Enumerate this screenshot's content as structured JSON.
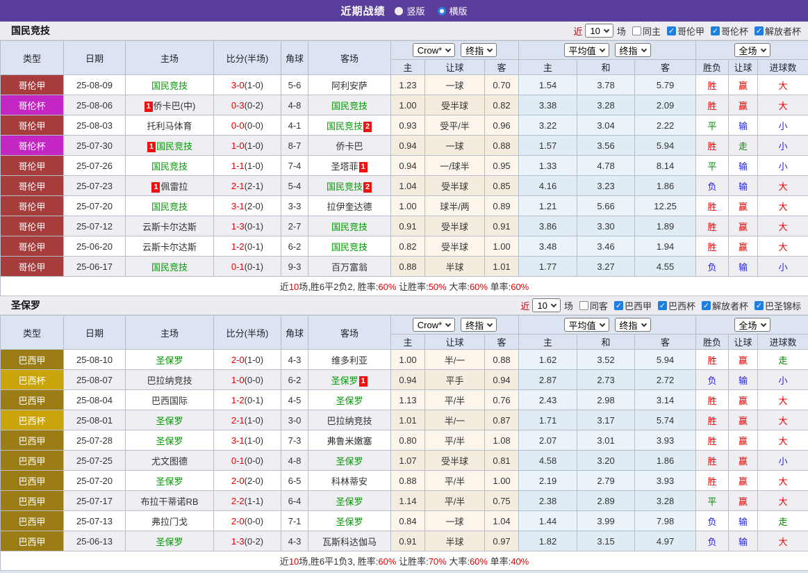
{
  "titlebar": {
    "title": "近期战绩",
    "radios": [
      {
        "label": "竖版",
        "style": "filled"
      },
      {
        "label": "横版",
        "style": "ring"
      }
    ]
  },
  "table_header": {
    "cols": [
      "类型",
      "日期",
      "主场",
      "比分(半场)",
      "角球",
      "客场"
    ],
    "sub": [
      "主",
      "让球",
      "客",
      "主",
      "和",
      "客",
      "胜负",
      "让球",
      "进球数"
    ],
    "selects": {
      "crow": "Crow*",
      "crow_final": "终指",
      "avg": "平均值",
      "avg_final": "终指",
      "full": "全场"
    }
  },
  "league_colors": {
    "哥伦甲": "#a73c3c",
    "哥伦杯": "#c426c4",
    "巴西甲": "#9c7c14",
    "巴西杯": "#c9a40c"
  },
  "result_colors": {
    "胜": "#e60000",
    "赢": "#e60000",
    "大": "#e60000",
    "平": "#008800",
    "走": "#008800",
    "负": "#2222dd",
    "输": "#2222dd",
    "小": "#2222dd"
  },
  "colors": {
    "titlebar": "#5a3e9b",
    "focus_team": "#009900",
    "score": "#e00000",
    "badge": "#ee1111"
  },
  "sections": [
    {
      "team": "国民竞技",
      "filters": {
        "near": "近",
        "count": "10",
        "unit": "场",
        "same": {
          "label": "同主",
          "checked": false
        },
        "leagues": [
          {
            "label": "哥伦甲",
            "checked": true
          },
          {
            "label": "哥伦杯",
            "checked": true
          },
          {
            "label": "解放者杯",
            "checked": true
          }
        ]
      },
      "rows": [
        {
          "league": "哥伦甲",
          "date": "25-08-09",
          "home": {
            "name": "国民竞技",
            "focus": true
          },
          "score": "3-0",
          "half": "(1-0)",
          "corner": "5-6",
          "away": {
            "name": "阿利安萨",
            "focus": false
          },
          "odds": [
            "1.23",
            "一球",
            "0.70",
            "1.54",
            "3.78",
            "5.79"
          ],
          "results": [
            "胜",
            "赢",
            "大"
          ]
        },
        {
          "league": "哥伦杯",
          "date": "25-08-06",
          "home": {
            "name": "侨卡巴(中)",
            "focus": false,
            "badge": "1"
          },
          "score": "0-3",
          "half": "(0-2)",
          "corner": "4-8",
          "away": {
            "name": "国民竞技",
            "focus": true
          },
          "odds": [
            "1.00",
            "受半球",
            "0.82",
            "3.38",
            "3.28",
            "2.09"
          ],
          "results": [
            "胜",
            "赢",
            "大"
          ]
        },
        {
          "league": "哥伦甲",
          "date": "25-08-03",
          "home": {
            "name": "托利马体育",
            "focus": false
          },
          "score": "0-0",
          "half": "(0-0)",
          "corner": "4-1",
          "away": {
            "name": "国民竞技",
            "focus": true,
            "badge": "2"
          },
          "odds": [
            "0.93",
            "受平/半",
            "0.96",
            "3.22",
            "3.04",
            "2.22"
          ],
          "results": [
            "平",
            "输",
            "小"
          ]
        },
        {
          "league": "哥伦杯",
          "date": "25-07-30",
          "home": {
            "name": "国民竞技",
            "focus": true,
            "badge": "1"
          },
          "score": "1-0",
          "half": "(1-0)",
          "corner": "8-7",
          "away": {
            "name": "侨卡巴",
            "focus": false
          },
          "odds": [
            "0.94",
            "一球",
            "0.88",
            "1.57",
            "3.56",
            "5.94"
          ],
          "results": [
            "胜",
            "走",
            "小"
          ]
        },
        {
          "league": "哥伦甲",
          "date": "25-07-26",
          "home": {
            "name": "国民竞技",
            "focus": true
          },
          "score": "1-1",
          "half": "(1-0)",
          "corner": "7-4",
          "away": {
            "name": "圣塔菲",
            "focus": false,
            "badge": "1"
          },
          "odds": [
            "0.94",
            "一/球半",
            "0.95",
            "1.33",
            "4.78",
            "8.14"
          ],
          "results": [
            "平",
            "输",
            "小"
          ]
        },
        {
          "league": "哥伦甲",
          "date": "25-07-23",
          "home": {
            "name": "佩雷拉",
            "focus": false,
            "badge": "1"
          },
          "score": "2-1",
          "half": "(2-1)",
          "corner": "5-4",
          "away": {
            "name": "国民竞技",
            "focus": true,
            "badge": "2"
          },
          "odds": [
            "1.04",
            "受半球",
            "0.85",
            "4.16",
            "3.23",
            "1.86"
          ],
          "results": [
            "负",
            "输",
            "大"
          ]
        },
        {
          "league": "哥伦甲",
          "date": "25-07-20",
          "home": {
            "name": "国民竞技",
            "focus": true
          },
          "score": "3-1",
          "half": "(2-0)",
          "corner": "3-3",
          "away": {
            "name": "拉伊奎达德",
            "focus": false
          },
          "odds": [
            "1.00",
            "球半/两",
            "0.89",
            "1.21",
            "5.66",
            "12.25"
          ],
          "results": [
            "胜",
            "赢",
            "大"
          ]
        },
        {
          "league": "哥伦甲",
          "date": "25-07-12",
          "home": {
            "name": "云斯卡尔达斯",
            "focus": false
          },
          "score": "1-3",
          "half": "(0-1)",
          "corner": "2-7",
          "away": {
            "name": "国民竞技",
            "focus": true
          },
          "odds": [
            "0.91",
            "受半球",
            "0.91",
            "3.86",
            "3.30",
            "1.89"
          ],
          "results": [
            "胜",
            "赢",
            "大"
          ]
        },
        {
          "league": "哥伦甲",
          "date": "25-06-20",
          "home": {
            "name": "云斯卡尔达斯",
            "focus": false
          },
          "score": "1-2",
          "half": "(0-1)",
          "corner": "6-2",
          "away": {
            "name": "国民竞技",
            "focus": true
          },
          "odds": [
            "0.82",
            "受半球",
            "1.00",
            "3.48",
            "3.46",
            "1.94"
          ],
          "results": [
            "胜",
            "赢",
            "大"
          ]
        },
        {
          "league": "哥伦甲",
          "date": "25-06-17",
          "home": {
            "name": "国民竞技",
            "focus": true
          },
          "score": "0-1",
          "half": "(0-1)",
          "corner": "9-3",
          "away": {
            "name": "百万富翁",
            "focus": false
          },
          "odds": [
            "0.88",
            "半球",
            "1.01",
            "1.77",
            "3.27",
            "4.55"
          ],
          "results": [
            "负",
            "输",
            "小"
          ]
        }
      ],
      "summary": [
        {
          "text": "近",
          "red": false
        },
        {
          "text": "10",
          "red": true
        },
        {
          "text": "场,胜6平2负2, 胜率:",
          "red": false
        },
        {
          "text": "60%",
          "red": true
        },
        {
          "text": " 让胜率:",
          "red": false
        },
        {
          "text": "50%",
          "red": true
        },
        {
          "text": " 大率:",
          "red": false
        },
        {
          "text": "60%",
          "red": true
        },
        {
          "text": " 单率:",
          "red": false
        },
        {
          "text": "60%",
          "red": true
        }
      ]
    },
    {
      "team": "圣保罗",
      "filters": {
        "near": "近",
        "count": "10",
        "unit": "场",
        "same": {
          "label": "同客",
          "checked": false
        },
        "leagues": [
          {
            "label": "巴西甲",
            "checked": true
          },
          {
            "label": "巴西杯",
            "checked": true
          },
          {
            "label": "解放者杯",
            "checked": true
          },
          {
            "label": "巴圣锦标",
            "checked": true
          }
        ]
      },
      "rows": [
        {
          "league": "巴西甲",
          "date": "25-08-10",
          "home": {
            "name": "圣保罗",
            "focus": true
          },
          "score": "2-0",
          "half": "(1-0)",
          "corner": "4-3",
          "away": {
            "name": "维多利亚",
            "focus": false
          },
          "odds": [
            "1.00",
            "半/一",
            "0.88",
            "1.62",
            "3.52",
            "5.94"
          ],
          "results": [
            "胜",
            "赢",
            "走"
          ]
        },
        {
          "league": "巴西杯",
          "date": "25-08-07",
          "home": {
            "name": "巴拉纳竞技",
            "focus": false
          },
          "score": "1-0",
          "half": "(0-0)",
          "corner": "6-2",
          "away": {
            "name": "圣保罗",
            "focus": true,
            "badge": "1"
          },
          "odds": [
            "0.94",
            "平手",
            "0.94",
            "2.87",
            "2.73",
            "2.72"
          ],
          "results": [
            "负",
            "输",
            "小"
          ]
        },
        {
          "league": "巴西甲",
          "date": "25-08-04",
          "home": {
            "name": "巴西国际",
            "focus": false
          },
          "score": "1-2",
          "half": "(0-1)",
          "corner": "4-5",
          "away": {
            "name": "圣保罗",
            "focus": true
          },
          "odds": [
            "1.13",
            "平/半",
            "0.76",
            "2.43",
            "2.98",
            "3.14"
          ],
          "results": [
            "胜",
            "赢",
            "大"
          ]
        },
        {
          "league": "巴西杯",
          "date": "25-08-01",
          "home": {
            "name": "圣保罗",
            "focus": true
          },
          "score": "2-1",
          "half": "(1-0)",
          "corner": "3-0",
          "away": {
            "name": "巴拉纳竞技",
            "focus": false
          },
          "odds": [
            "1.01",
            "半/一",
            "0.87",
            "1.71",
            "3.17",
            "5.74"
          ],
          "results": [
            "胜",
            "赢",
            "大"
          ]
        },
        {
          "league": "巴西甲",
          "date": "25-07-28",
          "home": {
            "name": "圣保罗",
            "focus": true
          },
          "score": "3-1",
          "half": "(1-0)",
          "corner": "7-3",
          "away": {
            "name": "弗鲁米嫩塞",
            "focus": false
          },
          "odds": [
            "0.80",
            "平/半",
            "1.08",
            "2.07",
            "3.01",
            "3.93"
          ],
          "results": [
            "胜",
            "赢",
            "大"
          ]
        },
        {
          "league": "巴西甲",
          "date": "25-07-25",
          "home": {
            "name": "尤文图德",
            "focus": false
          },
          "score": "0-1",
          "half": "(0-0)",
          "corner": "4-8",
          "away": {
            "name": "圣保罗",
            "focus": true
          },
          "odds": [
            "1.07",
            "受半球",
            "0.81",
            "4.58",
            "3.20",
            "1.86"
          ],
          "results": [
            "胜",
            "赢",
            "小"
          ]
        },
        {
          "league": "巴西甲",
          "date": "25-07-20",
          "home": {
            "name": "圣保罗",
            "focus": true
          },
          "score": "2-0",
          "half": "(2-0)",
          "corner": "6-5",
          "away": {
            "name": "科林蒂安",
            "focus": false
          },
          "odds": [
            "0.88",
            "平/半",
            "1.00",
            "2.19",
            "2.79",
            "3.93"
          ],
          "results": [
            "胜",
            "赢",
            "大"
          ]
        },
        {
          "league": "巴西甲",
          "date": "25-07-17",
          "home": {
            "name": "布拉干蒂诺RB",
            "focus": false
          },
          "score": "2-2",
          "half": "(1-1)",
          "corner": "6-4",
          "away": {
            "name": "圣保罗",
            "focus": true
          },
          "odds": [
            "1.14",
            "平/半",
            "0.75",
            "2.38",
            "2.89",
            "3.28"
          ],
          "results": [
            "平",
            "赢",
            "大"
          ]
        },
        {
          "league": "巴西甲",
          "date": "25-07-13",
          "home": {
            "name": "弗拉门戈",
            "focus": false
          },
          "score": "2-0",
          "half": "(0-0)",
          "corner": "7-1",
          "away": {
            "name": "圣保罗",
            "focus": true
          },
          "odds": [
            "0.84",
            "一球",
            "1.04",
            "1.44",
            "3.99",
            "7.98"
          ],
          "results": [
            "负",
            "输",
            "走"
          ]
        },
        {
          "league": "巴西甲",
          "date": "25-06-13",
          "home": {
            "name": "圣保罗",
            "focus": true
          },
          "score": "1-3",
          "half": "(0-2)",
          "corner": "4-3",
          "away": {
            "name": "瓦斯科达伽马",
            "focus": false
          },
          "odds": [
            "0.91",
            "半球",
            "0.97",
            "1.82",
            "3.15",
            "4.97"
          ],
          "results": [
            "负",
            "输",
            "大"
          ]
        }
      ],
      "summary": [
        {
          "text": "近",
          "red": false
        },
        {
          "text": "10",
          "red": true
        },
        {
          "text": "场,胜6平1负3, 胜率:",
          "red": false
        },
        {
          "text": "60%",
          "red": true
        },
        {
          "text": " 让胜率:",
          "red": false
        },
        {
          "text": "70%",
          "red": true
        },
        {
          "text": " 大率:",
          "red": false
        },
        {
          "text": "60%",
          "red": true
        },
        {
          "text": " 单率:",
          "red": false
        },
        {
          "text": "40%",
          "red": true
        }
      ]
    }
  ]
}
